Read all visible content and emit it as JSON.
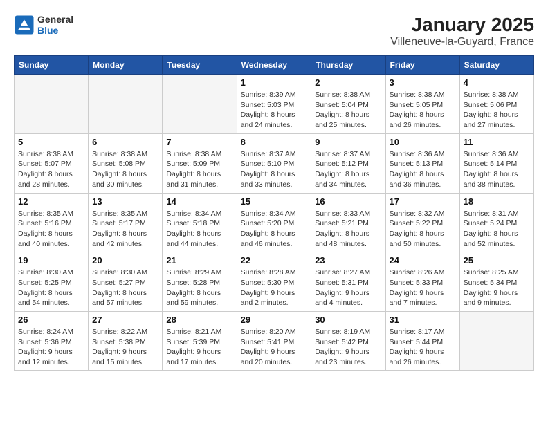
{
  "logo": {
    "general": "General",
    "blue": "Blue"
  },
  "title": "January 2025",
  "subtitle": "Villeneuve-la-Guyard, France",
  "days_of_week": [
    "Sunday",
    "Monday",
    "Tuesday",
    "Wednesday",
    "Thursday",
    "Friday",
    "Saturday"
  ],
  "weeks": [
    [
      {
        "day": "",
        "info": ""
      },
      {
        "day": "",
        "info": ""
      },
      {
        "day": "",
        "info": ""
      },
      {
        "day": "1",
        "info": "Sunrise: 8:39 AM\nSunset: 5:03 PM\nDaylight: 8 hours\nand 24 minutes."
      },
      {
        "day": "2",
        "info": "Sunrise: 8:38 AM\nSunset: 5:04 PM\nDaylight: 8 hours\nand 25 minutes."
      },
      {
        "day": "3",
        "info": "Sunrise: 8:38 AM\nSunset: 5:05 PM\nDaylight: 8 hours\nand 26 minutes."
      },
      {
        "day": "4",
        "info": "Sunrise: 8:38 AM\nSunset: 5:06 PM\nDaylight: 8 hours\nand 27 minutes."
      }
    ],
    [
      {
        "day": "5",
        "info": "Sunrise: 8:38 AM\nSunset: 5:07 PM\nDaylight: 8 hours\nand 28 minutes."
      },
      {
        "day": "6",
        "info": "Sunrise: 8:38 AM\nSunset: 5:08 PM\nDaylight: 8 hours\nand 30 minutes."
      },
      {
        "day": "7",
        "info": "Sunrise: 8:38 AM\nSunset: 5:09 PM\nDaylight: 8 hours\nand 31 minutes."
      },
      {
        "day": "8",
        "info": "Sunrise: 8:37 AM\nSunset: 5:10 PM\nDaylight: 8 hours\nand 33 minutes."
      },
      {
        "day": "9",
        "info": "Sunrise: 8:37 AM\nSunset: 5:12 PM\nDaylight: 8 hours\nand 34 minutes."
      },
      {
        "day": "10",
        "info": "Sunrise: 8:36 AM\nSunset: 5:13 PM\nDaylight: 8 hours\nand 36 minutes."
      },
      {
        "day": "11",
        "info": "Sunrise: 8:36 AM\nSunset: 5:14 PM\nDaylight: 8 hours\nand 38 minutes."
      }
    ],
    [
      {
        "day": "12",
        "info": "Sunrise: 8:35 AM\nSunset: 5:16 PM\nDaylight: 8 hours\nand 40 minutes."
      },
      {
        "day": "13",
        "info": "Sunrise: 8:35 AM\nSunset: 5:17 PM\nDaylight: 8 hours\nand 42 minutes."
      },
      {
        "day": "14",
        "info": "Sunrise: 8:34 AM\nSunset: 5:18 PM\nDaylight: 8 hours\nand 44 minutes."
      },
      {
        "day": "15",
        "info": "Sunrise: 8:34 AM\nSunset: 5:20 PM\nDaylight: 8 hours\nand 46 minutes."
      },
      {
        "day": "16",
        "info": "Sunrise: 8:33 AM\nSunset: 5:21 PM\nDaylight: 8 hours\nand 48 minutes."
      },
      {
        "day": "17",
        "info": "Sunrise: 8:32 AM\nSunset: 5:22 PM\nDaylight: 8 hours\nand 50 minutes."
      },
      {
        "day": "18",
        "info": "Sunrise: 8:31 AM\nSunset: 5:24 PM\nDaylight: 8 hours\nand 52 minutes."
      }
    ],
    [
      {
        "day": "19",
        "info": "Sunrise: 8:30 AM\nSunset: 5:25 PM\nDaylight: 8 hours\nand 54 minutes."
      },
      {
        "day": "20",
        "info": "Sunrise: 8:30 AM\nSunset: 5:27 PM\nDaylight: 8 hours\nand 57 minutes."
      },
      {
        "day": "21",
        "info": "Sunrise: 8:29 AM\nSunset: 5:28 PM\nDaylight: 8 hours\nand 59 minutes."
      },
      {
        "day": "22",
        "info": "Sunrise: 8:28 AM\nSunset: 5:30 PM\nDaylight: 9 hours\nand 2 minutes."
      },
      {
        "day": "23",
        "info": "Sunrise: 8:27 AM\nSunset: 5:31 PM\nDaylight: 9 hours\nand 4 minutes."
      },
      {
        "day": "24",
        "info": "Sunrise: 8:26 AM\nSunset: 5:33 PM\nDaylight: 9 hours\nand 7 minutes."
      },
      {
        "day": "25",
        "info": "Sunrise: 8:25 AM\nSunset: 5:34 PM\nDaylight: 9 hours\nand 9 minutes."
      }
    ],
    [
      {
        "day": "26",
        "info": "Sunrise: 8:24 AM\nSunset: 5:36 PM\nDaylight: 9 hours\nand 12 minutes."
      },
      {
        "day": "27",
        "info": "Sunrise: 8:22 AM\nSunset: 5:38 PM\nDaylight: 9 hours\nand 15 minutes."
      },
      {
        "day": "28",
        "info": "Sunrise: 8:21 AM\nSunset: 5:39 PM\nDaylight: 9 hours\nand 17 minutes."
      },
      {
        "day": "29",
        "info": "Sunrise: 8:20 AM\nSunset: 5:41 PM\nDaylight: 9 hours\nand 20 minutes."
      },
      {
        "day": "30",
        "info": "Sunrise: 8:19 AM\nSunset: 5:42 PM\nDaylight: 9 hours\nand 23 minutes."
      },
      {
        "day": "31",
        "info": "Sunrise: 8:17 AM\nSunset: 5:44 PM\nDaylight: 9 hours\nand 26 minutes."
      },
      {
        "day": "",
        "info": ""
      }
    ]
  ]
}
